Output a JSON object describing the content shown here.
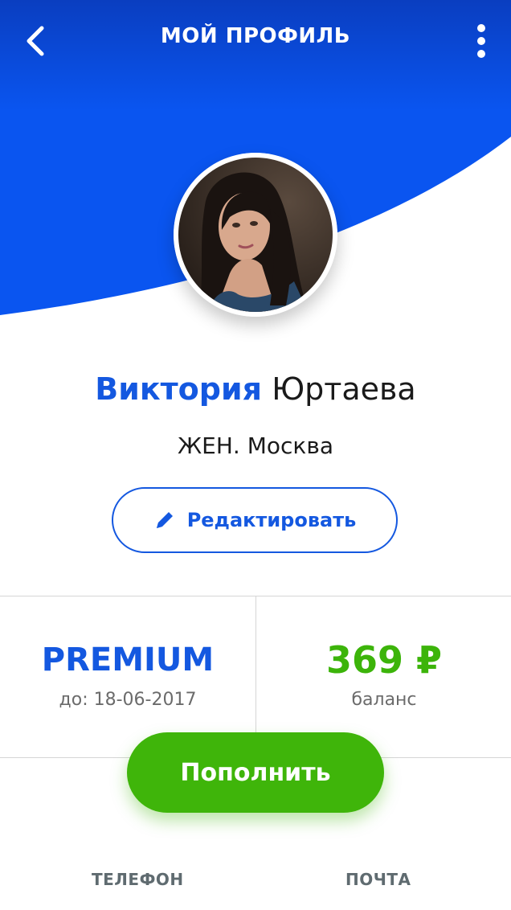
{
  "header": {
    "title": "МОЙ ПРОФИЛЬ"
  },
  "colors": {
    "brand_blue": "#1458e0",
    "header_blue": "#0a4fe0",
    "accent_green": "#3fb50a"
  },
  "profile": {
    "first_name": "Виктория",
    "last_name": "Юртаева",
    "subtitle": "ЖЕН. Москва",
    "edit_label": "Редактировать"
  },
  "stats": {
    "plan": "PREMIUM",
    "plan_caption": "до: 18-06-2017",
    "balance": "369 ₽",
    "balance_caption": "баланс"
  },
  "actions": {
    "topup_label": "Пополнить"
  },
  "tabs": {
    "phone": "ТЕЛЕФОН",
    "mail": "ПОЧТА"
  },
  "icons": {
    "back": "chevron-left-icon",
    "menu": "more-vertical-icon",
    "edit": "pencil-icon"
  }
}
